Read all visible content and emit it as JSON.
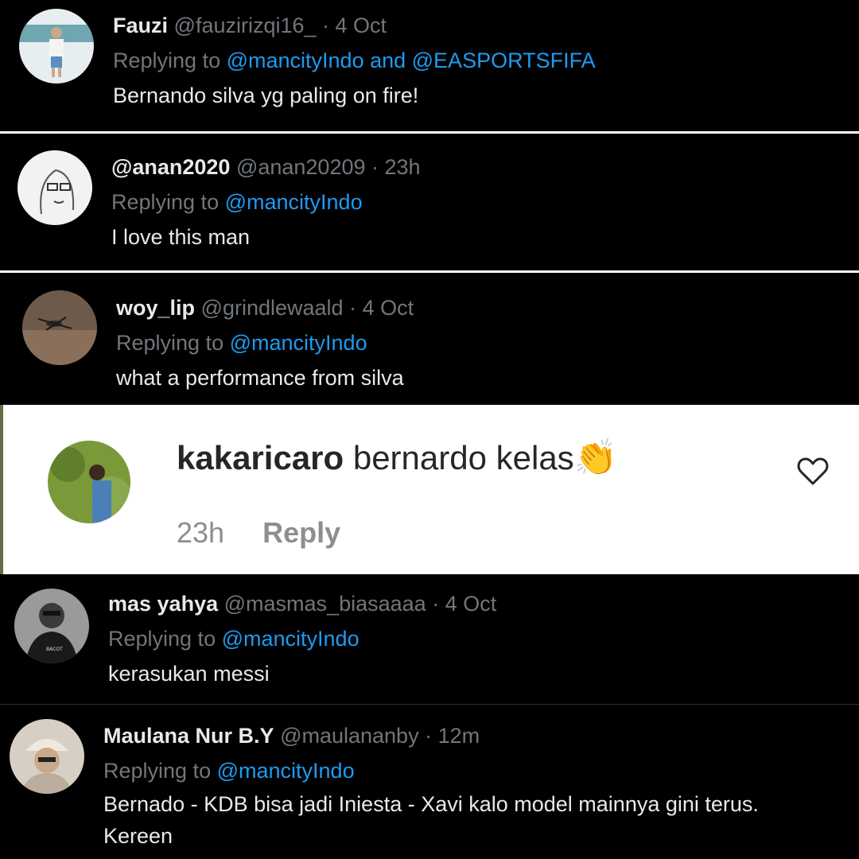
{
  "tweets": [
    {
      "name": "Fauzi",
      "handle": "@fauzirizqi16_",
      "time": "· 4 Oct",
      "replying": "Replying to",
      "mentions": "@mancityIndo and @EASPORTSFIFA",
      "text": "Bernando silva yg paling on fire!",
      "avatar_icon": "person-standing-avatar"
    },
    {
      "name": "@anan2020",
      "handle": "@anan20209",
      "time": "· 23h",
      "replying": "Replying to",
      "mentions": "@mancityIndo",
      "text": "I love this man",
      "avatar_icon": "sketch-face-avatar"
    },
    {
      "name": "woy_lip",
      "handle": "@grindlewaald",
      "time": "· 4 Oct",
      "replying": "Replying to",
      "mentions": "@mancityIndo",
      "text": "what a performance from silva",
      "avatar_icon": "insect-avatar"
    },
    {
      "name": "mas yahya",
      "handle": "@masmas_biasaaaa",
      "time": "· 4 Oct",
      "replying": "Replying to",
      "mentions": "@mancityIndo",
      "text": "kerasukan messi",
      "avatar_icon": "person-dark-avatar"
    },
    {
      "name": "Maulana Nur B.Y",
      "handle": "@maulananby",
      "time": "· 12m",
      "replying": "Replying to",
      "mentions": "@mancityIndo",
      "text": "Bernado - KDB bisa jadi Iniesta - Xavi kalo model mainnya gini terus.",
      "text2": "Kereen",
      "avatar_icon": "person-hat-avatar"
    }
  ],
  "instagram_comment": {
    "username": "kakaricaro",
    "text": "bernardo kelas",
    "emoji": "👏",
    "time": "23h",
    "reply_label": "Reply",
    "like_icon": "heart-outline-icon",
    "avatar_icon": "person-outdoor-avatar"
  },
  "colors": {
    "mention": "#1d9bf0",
    "muted": "#71767b",
    "background": "#000000"
  }
}
